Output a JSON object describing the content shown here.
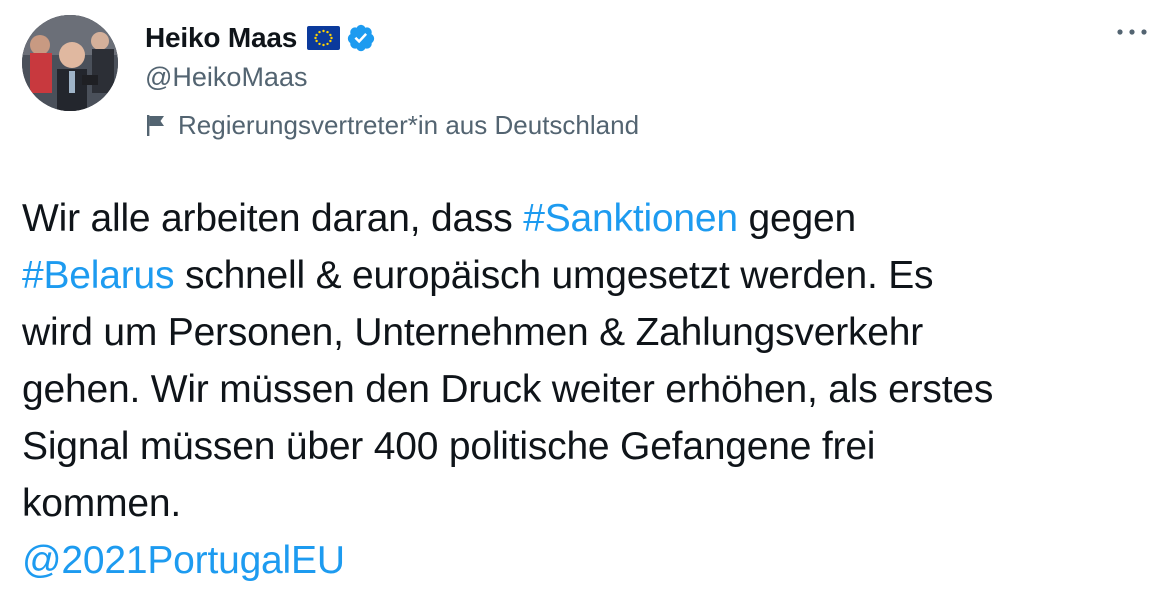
{
  "author": {
    "display_name": "Heiko Maas",
    "handle": "@HeikoMaas",
    "eu_flag_icon": "eu-flag-icon",
    "verified_icon": "verified-badge-icon",
    "verified_color": "#1d9bf0"
  },
  "account_label": {
    "icon": "flag-icon",
    "text": "Regierungsvertreter*in aus Deutschland"
  },
  "more_icon": "more-options-icon",
  "tweet": {
    "line1": {
      "text_a": "Wir alle arbeiten daran, dass ",
      "hashtag": "#Sanktionen",
      "text_b": " gegen"
    },
    "line2": {
      "hashtag": "#Belarus",
      "text": " schnell & europäisch umgesetzt werden. Es"
    },
    "line3": "wird um Personen, Unternehmen & Zahlungsverkehr",
    "line4": "gehen. Wir müssen den Druck weiter erhöhen, als erstes",
    "line5": "Signal müssen über 400 politische Gefangene frei",
    "line6": "kommen.",
    "mention": "@2021PortugalEU"
  },
  "colors": {
    "link": "#1d9bf0",
    "secondary_text": "#536471",
    "primary_text": "#0f1419"
  }
}
